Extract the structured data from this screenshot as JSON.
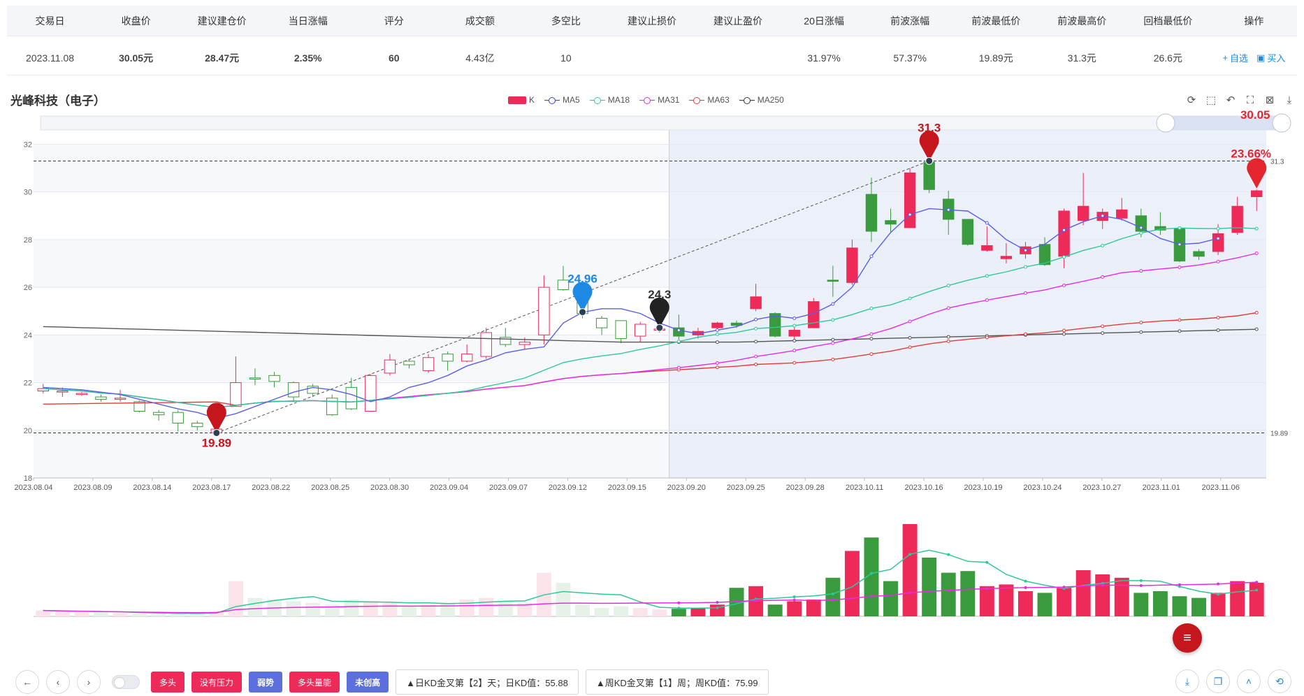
{
  "table": {
    "headers": [
      "交易日",
      "收盘价",
      "建议建仓价",
      "当日涨幅",
      "评分",
      "成交额",
      "多空比",
      "建议止损价",
      "建议止盈价",
      "20日涨幅",
      "前波涨幅",
      "前波最低价",
      "前波最高价",
      "回档最低价",
      "操作"
    ],
    "row": {
      "date": "2023.11.08",
      "close": "30.05元",
      "entry": "28.47元",
      "change": "2.35%",
      "score": "60",
      "turnover": "4.43亿",
      "ratio": "10",
      "stop_loss": "",
      "take_profit": "",
      "change20": "31.97%",
      "wave_gain": "57.37%",
      "wave_low": "19.89元",
      "wave_high": "31.3元",
      "pullback_low": "26.6元"
    },
    "ops": {
      "watch": "自选",
      "buy": "买入"
    }
  },
  "stock_title": "光峰科技（电子）",
  "legend": [
    {
      "name": "K",
      "color": "#ee2a59"
    },
    {
      "name": "MA5",
      "color": "#3b3fe0"
    },
    {
      "name": "MA18",
      "color": "#2fc79a"
    },
    {
      "name": "MA31",
      "color": "#e62be6"
    },
    {
      "name": "MA63",
      "color": "#e23b3b"
    },
    {
      "name": "MA250",
      "color": "#333333"
    }
  ],
  "toolbar": {
    "tags": [
      {
        "label": "多头",
        "color": "red"
      },
      {
        "label": "没有压力",
        "color": "red"
      },
      {
        "label": "弱势",
        "color": "blue"
      },
      {
        "label": "多头量能",
        "color": "red"
      },
      {
        "label": "未创高",
        "color": "blue"
      }
    ],
    "info1": "▲日KD金叉第【2】天；日KD值：55.88",
    "info2": "▲周KD金叉第【1】周；周KD值：75.99"
  },
  "chart_data": {
    "type": "candlestick",
    "y_ticks": [
      18,
      20,
      22,
      24,
      26,
      28,
      30,
      32
    ],
    "ylim": [
      18,
      32.6
    ],
    "x_tick_labels": [
      "2023.08.04",
      "2023.08.09",
      "2023.08.14",
      "2023.08.17",
      "2023.08.22",
      "2023.08.25",
      "2023.08.30",
      "2023.09.04",
      "2023.09.07",
      "2023.09.12",
      "2023.09.15",
      "2023.09.20",
      "2023.09.25",
      "2023.09.28",
      "2023.10.11",
      "2023.10.16",
      "2023.10.19",
      "2023.10.24",
      "2023.10.27",
      "2023.11.01",
      "2023.11.06"
    ],
    "candles": [
      {
        "o": 21.65,
        "c": 21.75,
        "h": 21.95,
        "l": 21.55
      },
      {
        "o": 21.6,
        "c": 21.65,
        "h": 21.8,
        "l": 21.4
      },
      {
        "o": 21.5,
        "c": 21.55,
        "h": 21.6,
        "l": 21.45
      },
      {
        "o": 21.4,
        "c": 21.3,
        "h": 21.5,
        "l": 21.2
      },
      {
        "o": 21.3,
        "c": 21.35,
        "h": 21.7,
        "l": 21.2
      },
      {
        "o": 21.2,
        "c": 20.8,
        "h": 21.25,
        "l": 20.75
      },
      {
        "o": 20.75,
        "c": 20.65,
        "h": 20.85,
        "l": 20.4
      },
      {
        "o": 20.75,
        "c": 20.3,
        "h": 20.85,
        "l": 19.95
      },
      {
        "o": 20.3,
        "c": 20.15,
        "h": 20.4,
        "l": 20.0
      },
      {
        "o": 19.9,
        "c": 20.05,
        "h": 20.3,
        "l": 19.89
      },
      {
        "o": 21.0,
        "c": 22.0,
        "h": 23.1,
        "l": 21.0
      },
      {
        "o": 22.2,
        "c": 22.15,
        "h": 22.6,
        "l": 21.9
      },
      {
        "o": 22.3,
        "c": 22.05,
        "h": 22.45,
        "l": 21.8
      },
      {
        "o": 22.0,
        "c": 21.4,
        "h": 22.05,
        "l": 21.2
      },
      {
        "o": 21.85,
        "c": 21.55,
        "h": 21.95,
        "l": 21.4
      },
      {
        "o": 21.35,
        "c": 20.65,
        "h": 21.5,
        "l": 20.6
      },
      {
        "o": 21.8,
        "c": 20.9,
        "h": 22.2,
        "l": 20.85
      },
      {
        "o": 20.8,
        "c": 22.3,
        "h": 22.35,
        "l": 20.8
      },
      {
        "o": 22.4,
        "c": 22.95,
        "h": 23.2,
        "l": 22.3
      },
      {
        "o": 22.9,
        "c": 22.75,
        "h": 23.0,
        "l": 22.6
      },
      {
        "o": 22.5,
        "c": 23.05,
        "h": 23.2,
        "l": 22.4
      },
      {
        "o": 23.2,
        "c": 22.9,
        "h": 23.3,
        "l": 22.5
      },
      {
        "o": 22.9,
        "c": 23.2,
        "h": 23.6,
        "l": 22.85
      },
      {
        "o": 23.1,
        "c": 24.1,
        "h": 24.3,
        "l": 23.0
      },
      {
        "o": 23.9,
        "c": 23.6,
        "h": 24.3,
        "l": 23.5
      },
      {
        "o": 23.6,
        "c": 23.7,
        "h": 23.9,
        "l": 23.4
      },
      {
        "o": 24.0,
        "c": 26.0,
        "h": 26.5,
        "l": 23.6
      },
      {
        "o": 26.3,
        "c": 25.9,
        "h": 26.9,
        "l": 25.85
      },
      {
        "o": 25.8,
        "c": 24.9,
        "h": 25.9,
        "l": 24.7
      },
      {
        "o": 24.7,
        "c": 24.3,
        "h": 24.8,
        "l": 24.0
      },
      {
        "o": 24.6,
        "c": 23.85,
        "h": 24.6,
        "l": 23.65
      },
      {
        "o": 23.95,
        "c": 24.45,
        "h": 24.55,
        "l": 23.7
      },
      {
        "o": 24.2,
        "c": 24.25,
        "h": 24.35,
        "l": 24.1
      },
      {
        "o": 24.3,
        "c": 23.95,
        "h": 24.85,
        "l": 23.8
      },
      {
        "o": 24.0,
        "c": 24.15,
        "h": 24.3,
        "l": 23.85
      },
      {
        "o": 24.3,
        "c": 24.5,
        "h": 24.55,
        "l": 24.2
      },
      {
        "o": 24.5,
        "c": 24.4,
        "h": 24.6,
        "l": 24.3
      },
      {
        "o": 25.1,
        "c": 25.6,
        "h": 26.15,
        "l": 25.0
      },
      {
        "o": 24.9,
        "c": 23.95,
        "h": 24.95,
        "l": 23.9
      },
      {
        "o": 23.95,
        "c": 24.2,
        "h": 24.4,
        "l": 23.8
      },
      {
        "o": 24.3,
        "c": 25.4,
        "h": 25.55,
        "l": 24.3
      },
      {
        "o": 26.3,
        "c": 26.25,
        "h": 26.9,
        "l": 25.6
      },
      {
        "o": 26.2,
        "c": 27.65,
        "h": 28.0,
        "l": 26.1
      },
      {
        "o": 29.9,
        "c": 28.35,
        "h": 30.6,
        "l": 27.9
      },
      {
        "o": 28.8,
        "c": 28.65,
        "h": 29.3,
        "l": 28.3
      },
      {
        "o": 28.5,
        "c": 30.8,
        "h": 31.0,
        "l": 28.5
      },
      {
        "o": 31.25,
        "c": 30.1,
        "h": 31.3,
        "l": 29.95
      },
      {
        "o": 29.7,
        "c": 28.85,
        "h": 30.05,
        "l": 28.2
      },
      {
        "o": 28.85,
        "c": 27.8,
        "h": 28.85,
        "l": 27.75
      },
      {
        "o": 27.55,
        "c": 27.75,
        "h": 28.55,
        "l": 27.5
      },
      {
        "o": 27.2,
        "c": 27.3,
        "h": 27.85,
        "l": 27.0
      },
      {
        "o": 27.4,
        "c": 27.7,
        "h": 27.9,
        "l": 27.2
      },
      {
        "o": 27.8,
        "c": 26.95,
        "h": 28.1,
        "l": 26.9
      },
      {
        "o": 27.3,
        "c": 29.2,
        "h": 29.3,
        "l": 26.8
      },
      {
        "o": 28.8,
        "c": 29.4,
        "h": 30.8,
        "l": 28.6
      },
      {
        "o": 28.8,
        "c": 29.15,
        "h": 29.3,
        "l": 28.45
      },
      {
        "o": 28.9,
        "c": 29.25,
        "h": 29.75,
        "l": 28.8
      },
      {
        "o": 29.0,
        "c": 28.35,
        "h": 29.3,
        "l": 28.1
      },
      {
        "o": 28.55,
        "c": 28.4,
        "h": 29.15,
        "l": 28.2
      },
      {
        "o": 28.45,
        "c": 27.1,
        "h": 28.45,
        "l": 27.05
      },
      {
        "o": 27.5,
        "c": 27.3,
        "h": 27.6,
        "l": 27.15
      },
      {
        "o": 27.5,
        "c": 28.25,
        "h": 28.65,
        "l": 27.35
      },
      {
        "o": 28.3,
        "c": 29.4,
        "h": 29.8,
        "l": 28.2
      },
      {
        "o": 29.8,
        "c": 30.05,
        "h": 30.1,
        "l": 29.2
      }
    ],
    "volume": [
      7,
      6,
      5,
      5,
      4,
      3,
      3,
      3,
      4,
      6,
      42,
      22,
      20,
      18,
      16,
      14,
      20,
      18,
      16,
      12,
      14,
      16,
      20,
      22,
      18,
      16,
      52,
      40,
      14,
      10,
      12,
      10,
      8,
      9,
      10,
      14,
      34,
      36,
      14,
      18,
      20,
      46,
      78,
      94,
      42,
      110,
      70,
      52,
      54,
      36,
      38,
      30,
      28,
      34,
      55,
      50,
      46,
      28,
      30,
      24,
      22,
      28,
      42,
      40
    ],
    "volume_ylim": [
      0,
      120
    ],
    "ma5": [
      21.8,
      21.75,
      21.7,
      21.6,
      21.5,
      21.3,
      21.1,
      20.9,
      20.75,
      20.5,
      20.7,
      21.0,
      21.3,
      21.6,
      21.8,
      21.7,
      21.5,
      21.2,
      21.4,
      21.8,
      22.0,
      22.3,
      22.7,
      22.95,
      23.25,
      23.4,
      23.5,
      24.5,
      24.95,
      25.1,
      25.1,
      24.9,
      24.5,
      24.2,
      24.05,
      24.2,
      24.35,
      24.65,
      24.8,
      24.7,
      24.9,
      25.3,
      26.0,
      27.3,
      28.3,
      29.05,
      29.3,
      29.25,
      29.2,
      28.7,
      28.0,
      27.55,
      27.8,
      28.4,
      28.75,
      29.0,
      28.85,
      28.5,
      28.05,
      27.8,
      27.85,
      28.05
    ]
  },
  "annotations": {
    "high_mark": "31.3",
    "low_mark": "19.89",
    "mark_2496": "24.96",
    "mark_243": "24.3",
    "last_price": "30.05",
    "last_pct": "23.66%",
    "axis_right_high": "31.3",
    "axis_right_low": "19.89"
  }
}
